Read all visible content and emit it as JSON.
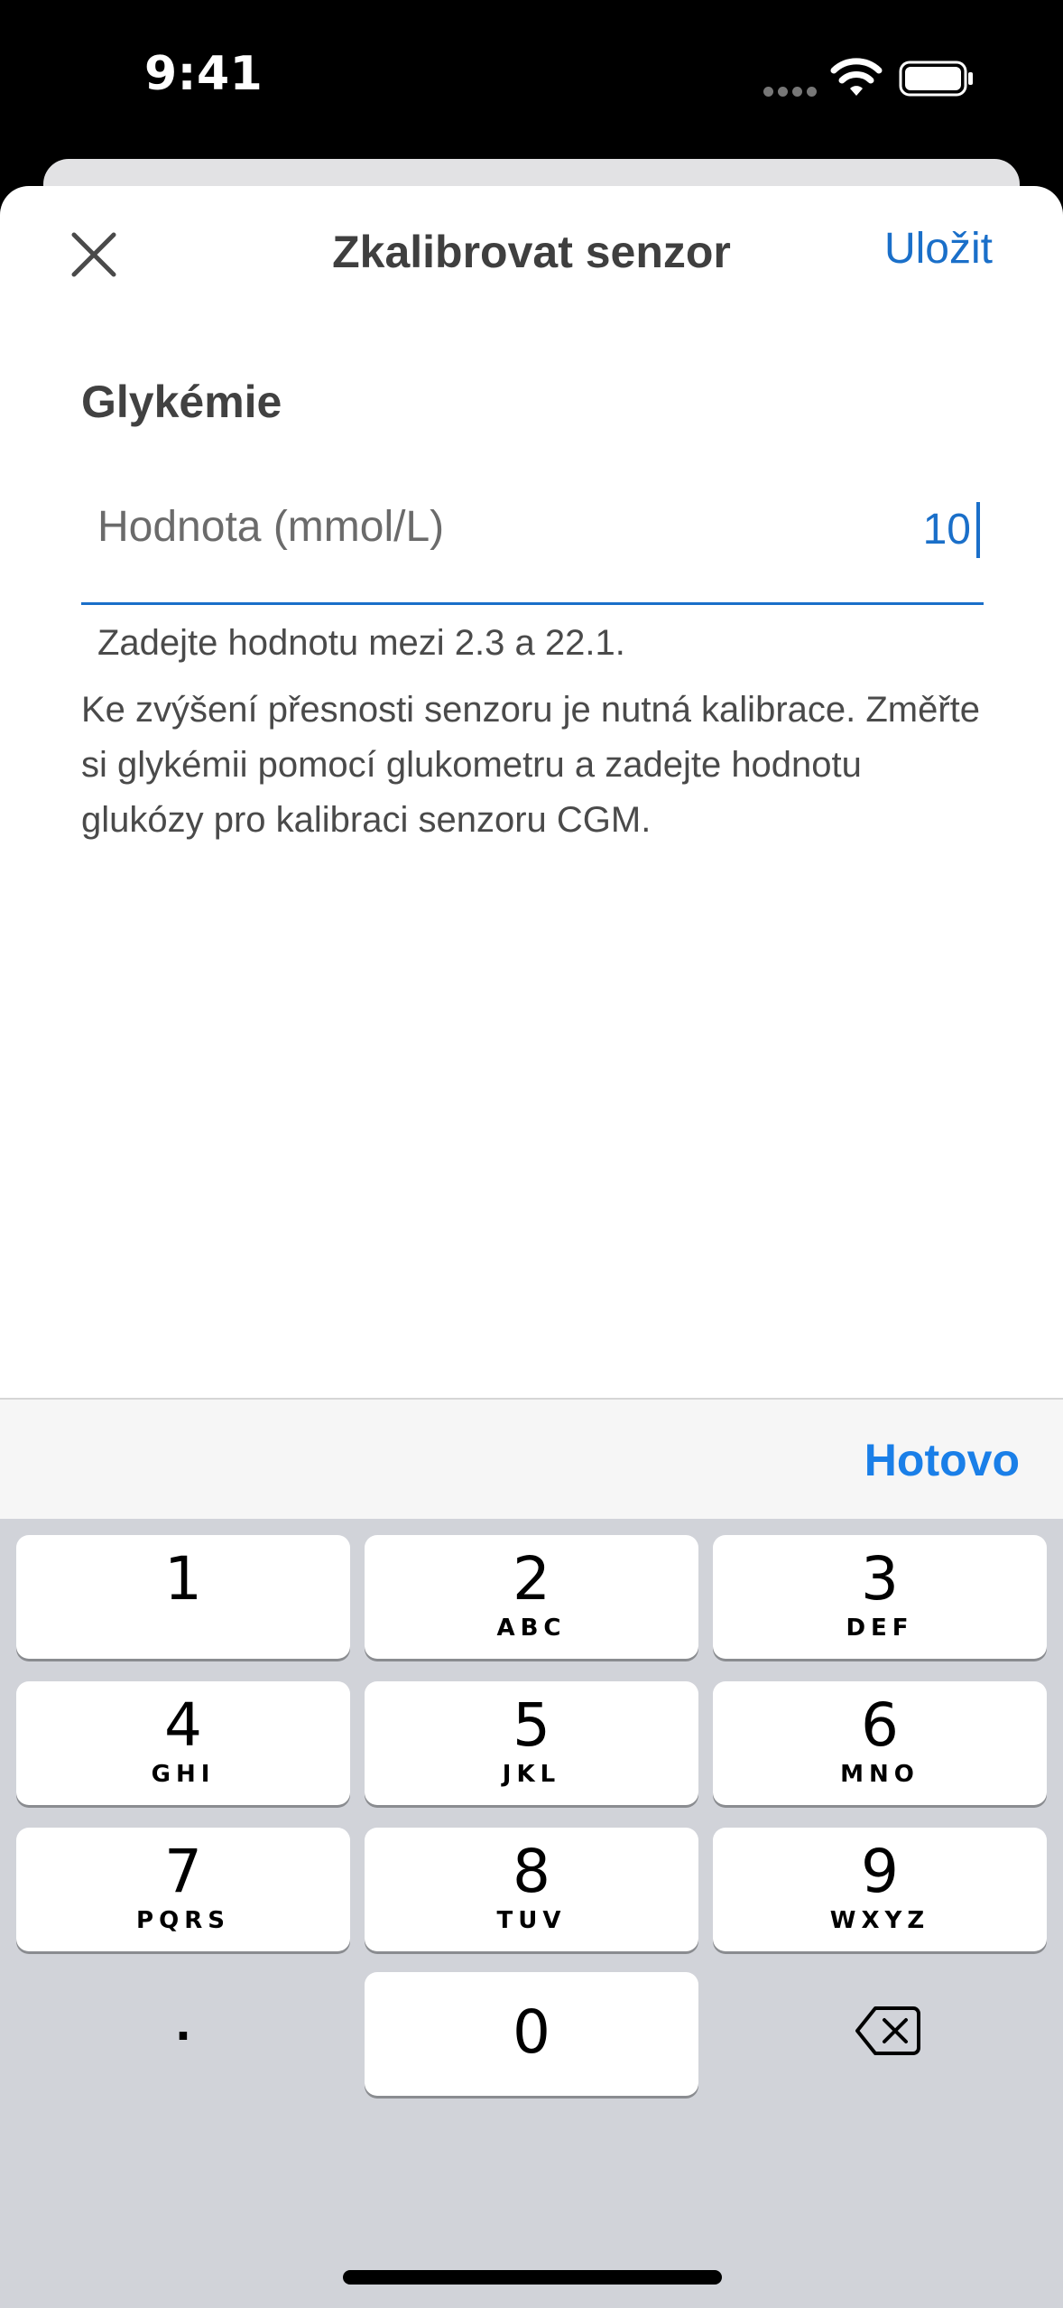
{
  "status_bar": {
    "time": "9:41"
  },
  "header": {
    "title": "Zkalibrovat senzor",
    "save_label": "Uložit",
    "close_icon": "close-icon"
  },
  "form": {
    "section_label": "Glykémie",
    "input_label": "Hodnota (mmol/L)",
    "input_value": "10",
    "hint": "Zadejte hodnotu mezi 2.3 a 22.1.",
    "description": "Ke zvýšení přesnosti senzoru je nutná kalibrace. Změřte si glykémii pomocí glukometru a zadejte hodnotu glukózy pro kalibraci senzoru CGM."
  },
  "keyboard": {
    "done_label": "Hotovo",
    "keys": [
      {
        "digit": "1",
        "letters": ""
      },
      {
        "digit": "2",
        "letters": "ABC"
      },
      {
        "digit": "3",
        "letters": "DEF"
      },
      {
        "digit": "4",
        "letters": "GHI"
      },
      {
        "digit": "5",
        "letters": "JKL"
      },
      {
        "digit": "6",
        "letters": "MNO"
      },
      {
        "digit": "7",
        "letters": "PQRS"
      },
      {
        "digit": "8",
        "letters": "TUV"
      },
      {
        "digit": "9",
        "letters": "WXYZ"
      },
      {
        "digit": "0",
        "letters": ""
      }
    ],
    "dot_label": ".",
    "delete_icon": "backspace-icon"
  },
  "colors": {
    "accent": "#1a6fc9",
    "done": "#1a7fe8",
    "keypad_bg": "#d1d3d9"
  }
}
